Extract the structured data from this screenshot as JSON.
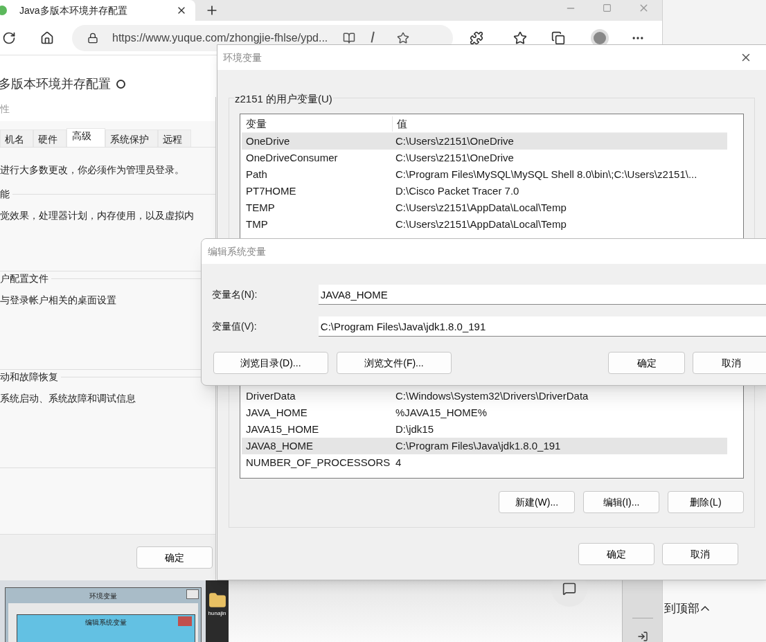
{
  "browser": {
    "tab": {
      "title": "Java多版本环境并存配置"
    },
    "address": "https://www.yuque.com/zhongjie-fhlse/ypd...",
    "page_title": "多版本环境并存配置",
    "back_to_top": "到顶部"
  },
  "system_properties": {
    "title": "性",
    "tabs": [
      {
        "label": "机名",
        "selected": false
      },
      {
        "label": "硬件",
        "selected": false
      },
      {
        "label": "高级",
        "selected": true
      },
      {
        "label": "系统保护",
        "selected": false
      },
      {
        "label": "远程",
        "selected": false
      }
    ],
    "notice": "进行大多数更改，你必须作为管理员登录。",
    "sections": [
      {
        "title": "能",
        "description": "觉效果，处理器计划，内存使用，以及虚拟内"
      },
      {
        "title": "户配置文件",
        "description": "与登录帐户相关的桌面设置"
      },
      {
        "title": "动和故障恢复",
        "description": "系统启动、系统故障和调试信息"
      }
    ],
    "ok_button": "确定"
  },
  "environment_variables": {
    "title": "环境变量",
    "user_group": "z2151 的用户变量(U)",
    "columns": [
      "变量",
      "值"
    ],
    "user_rows": [
      {
        "name": "OneDrive",
        "value": "C:\\Users\\z2151\\OneDrive",
        "selected": true
      },
      {
        "name": "OneDriveConsumer",
        "value": "C:\\Users\\z2151\\OneDrive",
        "selected": false
      },
      {
        "name": "Path",
        "value": "C:\\Program Files\\MySQL\\MySQL Shell 8.0\\bin\\;C:\\Users\\z2151\\...",
        "selected": false
      },
      {
        "name": "PT7HOME",
        "value": "D:\\Cisco Packet Tracer 7.0",
        "selected": false
      },
      {
        "name": "TEMP",
        "value": "C:\\Users\\z2151\\AppData\\Local\\Temp",
        "selected": false
      },
      {
        "name": "TMP",
        "value": "C:\\Users\\z2151\\AppData\\Local\\Temp",
        "selected": false
      }
    ],
    "system_rows": [
      {
        "name": "DriverData",
        "value": "C:\\Windows\\System32\\Drivers\\DriverData",
        "selected": false
      },
      {
        "name": "JAVA_HOME",
        "value": "%JAVA15_HOME%",
        "selected": false
      },
      {
        "name": "JAVA15_HOME",
        "value": "D:\\jdk15",
        "selected": false
      },
      {
        "name": "JAVA8_HOME",
        "value": "C:\\Program Files\\Java\\jdk1.8.0_191",
        "selected": true
      },
      {
        "name": "NUMBER_OF_PROCESSORS",
        "value": "4",
        "selected": false
      }
    ],
    "system_buttons": [
      "新建(W)...",
      "编辑(I)...",
      "删除(L)"
    ],
    "buttons": [
      "确定",
      "取消"
    ]
  },
  "edit_dialog": {
    "title": "编辑系统变量",
    "fields": [
      {
        "label": "变量名(N):",
        "value": "JAVA8_HOME"
      },
      {
        "label": "变量值(V):",
        "value": "C:\\Program Files\\Java\\jdk1.8.0_191"
      }
    ],
    "browse_buttons": [
      "浏览目录(D)...",
      "浏览文件(F)..."
    ],
    "buttons": [
      "确定",
      "取消"
    ]
  },
  "thumbnail": {
    "window_title": "环境变量",
    "dialog_title": "编辑系统变量"
  },
  "desktop": {
    "folder_label": "hunajin"
  }
}
